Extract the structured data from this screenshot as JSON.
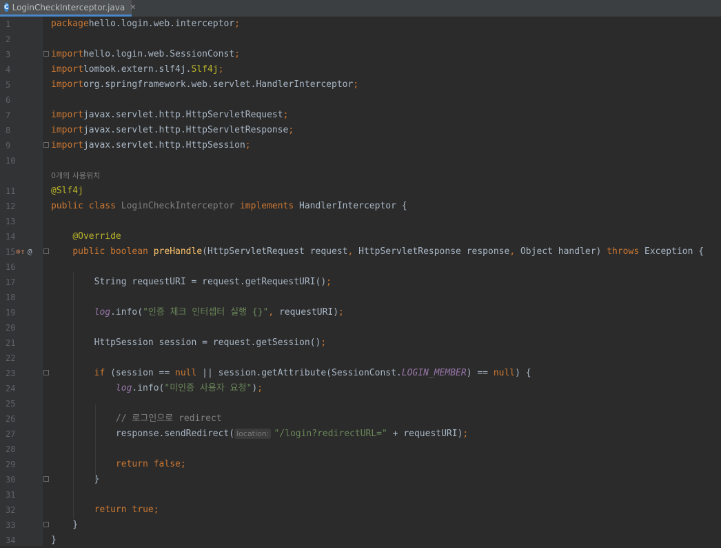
{
  "tab": {
    "title": "LoginCheckInterceptor.java",
    "icon_letter": "C"
  },
  "usage_hint": "0개의 사용위치",
  "param_hint": "location:",
  "lines": [
    {
      "n": "1",
      "segs": [
        [
          "k",
          "package"
        ],
        [
          "",
          "hello.login.web.interceptor"
        ],
        [
          "k",
          ";"
        ]
      ]
    },
    {
      "n": "2",
      "segs": []
    },
    {
      "n": "3",
      "segs": [
        [
          "k",
          "import"
        ],
        [
          "",
          "hello.login.web.SessionConst"
        ],
        [
          "k",
          ";"
        ]
      ]
    },
    {
      "n": "4",
      "segs": [
        [
          "k",
          "import"
        ],
        [
          "",
          "lombok.extern.slf4j."
        ],
        [
          "ann",
          "Slf4j"
        ],
        [
          "k",
          ";"
        ]
      ]
    },
    {
      "n": "5",
      "segs": [
        [
          "k",
          "import"
        ],
        [
          "",
          "org.springframework.web.servlet.HandlerInterceptor"
        ],
        [
          "k",
          ";"
        ]
      ]
    },
    {
      "n": "6",
      "segs": []
    },
    {
      "n": "7",
      "segs": [
        [
          "k",
          "import"
        ],
        [
          "",
          "javax.servlet.http.HttpServletRequest"
        ],
        [
          "k",
          ";"
        ]
      ]
    },
    {
      "n": "8",
      "segs": [
        [
          "k",
          "import"
        ],
        [
          "",
          "javax.servlet.http.HttpServletResponse"
        ],
        [
          "k",
          ";"
        ]
      ]
    },
    {
      "n": "9",
      "segs": [
        [
          "k",
          "import"
        ],
        [
          "",
          "javax.servlet.http.HttpSession"
        ],
        [
          "k",
          ";"
        ]
      ]
    },
    {
      "n": "10",
      "segs": []
    },
    {
      "n": "11",
      "segs": [
        [
          "ann",
          "@Slf4j"
        ]
      ]
    },
    {
      "n": "12",
      "segs": [
        [
          "k",
          "public class "
        ],
        [
          "cls",
          "LoginCheckInterceptor "
        ],
        [
          "k",
          "implements "
        ],
        [
          "",
          "HandlerInterceptor {"
        ]
      ]
    },
    {
      "n": "13",
      "segs": []
    },
    {
      "n": "14",
      "segs": [
        [
          "",
          "    "
        ],
        [
          "ann",
          "@Override"
        ]
      ]
    },
    {
      "n": "15",
      "segs": [
        [
          "",
          "    "
        ],
        [
          "k",
          "public boolean "
        ],
        [
          "fn",
          "preHandle"
        ],
        [
          "",
          "(HttpServletRequest request"
        ],
        [
          "k",
          ", "
        ],
        [
          "",
          "HttpServletResponse response"
        ],
        [
          "k",
          ", "
        ],
        [
          "",
          "Object handler) "
        ],
        [
          "k",
          "throws "
        ],
        [
          "",
          "Exception {"
        ]
      ]
    },
    {
      "n": "16",
      "segs": []
    },
    {
      "n": "17",
      "segs": [
        [
          "",
          "        String requestURI = request.getRequestURI()"
        ],
        [
          "k",
          ";"
        ]
      ]
    },
    {
      "n": "18",
      "segs": []
    },
    {
      "n": "19",
      "segs": [
        [
          "",
          "        "
        ],
        [
          "st2",
          "log"
        ],
        [
          "",
          ".info("
        ],
        [
          "str",
          "\"인증 체크 인터셉터 실행 {}\""
        ],
        [
          "k",
          ", "
        ],
        [
          "",
          "requestURI)"
        ],
        [
          "k",
          ";"
        ]
      ]
    },
    {
      "n": "20",
      "segs": []
    },
    {
      "n": "21",
      "segs": [
        [
          "",
          "        HttpSession session = request.getSession()"
        ],
        [
          "k",
          ";"
        ]
      ]
    },
    {
      "n": "22",
      "segs": []
    },
    {
      "n": "23",
      "segs": [
        [
          "",
          "        "
        ],
        [
          "k",
          "if "
        ],
        [
          "",
          "(session == "
        ],
        [
          "k",
          "null "
        ],
        [
          "",
          "|| session.getAttribute(SessionConst."
        ],
        [
          "st",
          "LOGIN_MEMBER"
        ],
        [
          "",
          ") == "
        ],
        [
          "k",
          "null"
        ],
        [
          "",
          ") {"
        ]
      ]
    },
    {
      "n": "24",
      "segs": [
        [
          "",
          "            "
        ],
        [
          "st2",
          "log"
        ],
        [
          "",
          ".info("
        ],
        [
          "str",
          "\"미인증 사용자 요청\""
        ],
        [
          "",
          ")"
        ],
        [
          "k",
          ";"
        ]
      ]
    },
    {
      "n": "25",
      "segs": []
    },
    {
      "n": "26",
      "segs": [
        [
          "",
          "            "
        ],
        [
          "cm",
          "// 로그인으로 redirect"
        ]
      ]
    },
    {
      "n": "27",
      "segs": [
        [
          "",
          "            response.sendRedirect("
        ],
        [
          "hint",
          "location:"
        ],
        [
          "str",
          "\"/login?redirectURL=\""
        ],
        [
          "",
          " + requestURI)"
        ],
        [
          "k",
          ";"
        ]
      ]
    },
    {
      "n": "28",
      "segs": []
    },
    {
      "n": "29",
      "segs": [
        [
          "",
          "            "
        ],
        [
          "k",
          "return false;"
        ]
      ]
    },
    {
      "n": "30",
      "segs": [
        [
          "",
          "        }"
        ]
      ]
    },
    {
      "n": "31",
      "segs": []
    },
    {
      "n": "32",
      "segs": [
        [
          "",
          "        "
        ],
        [
          "k",
          "return true;"
        ]
      ]
    },
    {
      "n": "33",
      "segs": [
        [
          "",
          "    }"
        ]
      ]
    },
    {
      "n": "34",
      "segs": [
        [
          "",
          "}"
        ]
      ]
    }
  ],
  "colors": {
    "keyword": "#cc7832",
    "annotation": "#bbb529",
    "string": "#6a8759",
    "method": "#ffc66d",
    "static_field": "#9876aa",
    "comment": "#808080",
    "text": "#a9b7c6"
  }
}
